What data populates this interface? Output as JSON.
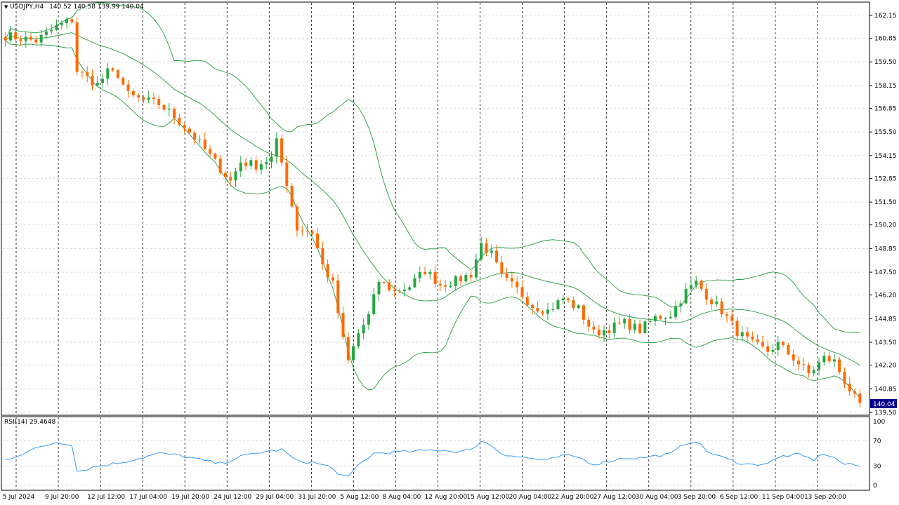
{
  "header": {
    "symbol_label": "USDJPY,H4",
    "ohlc": "140.52 140.58 139.99 140.04"
  },
  "indicator": {
    "label": "RSI(14) 29.4648"
  },
  "current_price_label": "140.04",
  "colors": {
    "bull": "#26a641",
    "bear": "#ff6a00",
    "band": "#1e9b3a",
    "rsi": "#1e90ff",
    "grid": "#c8c8c8",
    "price_box": "#00008b"
  },
  "chart_data": {
    "type": "candlestick",
    "symbol": "USDJPY",
    "timeframe": "H4",
    "y_axis_price": {
      "ticks": [
        "162.15",
        "160.85",
        "159.50",
        "158.15",
        "156.85",
        "155.50",
        "154.15",
        "152.85",
        "151.50",
        "150.20",
        "148.85",
        "147.50",
        "146.20",
        "144.85",
        "143.50",
        "142.20",
        "140.85",
        "139.50"
      ],
      "ylim": [
        139.5,
        162.15
      ]
    },
    "y_axis_rsi": {
      "ticks": [
        "100",
        "70",
        "30",
        "0"
      ],
      "ylim": [
        0,
        100
      ]
    },
    "x_axis_labels": [
      "5 Jul 2024",
      "9 Jul 20:00",
      "12 Jul 12:00",
      "17 Jul 04:00",
      "19 Jul 20:00",
      "24 Jul 12:00",
      "29 Jul 04:00",
      "31 Jul 20:00",
      "5 Aug 12:00",
      "8 Aug 04:00",
      "12 Aug 20:00",
      "15 Aug 12:00",
      "20 Aug 04:00",
      "22 Aug 20:00",
      "27 Aug 12:00",
      "30 Aug 04:00",
      "3 Sep 20:00",
      "6 Sep 12:00",
      "11 Sep 04:00",
      "13 Sep 20:00"
    ],
    "close_path": [
      [
        0,
        161.0
      ],
      [
        6,
        160.7
      ],
      [
        10,
        161.5
      ],
      [
        13,
        161.9
      ],
      [
        14,
        159.0
      ],
      [
        16,
        158.6
      ],
      [
        18,
        158.2
      ],
      [
        20,
        158.9
      ],
      [
        22,
        158.8
      ],
      [
        24,
        157.6
      ],
      [
        27,
        157.3
      ],
      [
        30,
        157.1
      ],
      [
        33,
        156.4
      ],
      [
        36,
        155.5
      ],
      [
        39,
        154.5
      ],
      [
        42,
        153.4
      ],
      [
        44,
        152.7
      ],
      [
        46,
        153.8
      ],
      [
        49,
        153.6
      ],
      [
        52,
        154.0
      ],
      [
        53,
        154.9
      ],
      [
        55,
        152.6
      ],
      [
        57,
        150.0
      ],
      [
        60,
        149.8
      ],
      [
        62,
        147.9
      ],
      [
        64,
        146.8
      ],
      [
        66,
        143.6
      ],
      [
        67,
        142.4
      ],
      [
        69,
        144.0
      ],
      [
        71,
        145.0
      ],
      [
        73,
        147.0
      ],
      [
        76,
        146.4
      ],
      [
        79,
        146.7
      ],
      [
        82,
        147.6
      ],
      [
        85,
        146.8
      ],
      [
        88,
        147.0
      ],
      [
        91,
        147.4
      ],
      [
        93,
        149.1
      ],
      [
        95,
        148.5
      ],
      [
        97,
        147.2
      ],
      [
        100,
        146.5
      ],
      [
        103,
        145.6
      ],
      [
        106,
        145.3
      ],
      [
        109,
        146.0
      ],
      [
        112,
        145.4
      ],
      [
        115,
        144.0
      ],
      [
        118,
        144.3
      ],
      [
        121,
        144.6
      ],
      [
        124,
        144.2
      ],
      [
        127,
        144.9
      ],
      [
        130,
        145.1
      ],
      [
        133,
        146.4
      ],
      [
        135,
        146.9
      ],
      [
        137,
        146.2
      ],
      [
        140,
        145.3
      ],
      [
        143,
        144.1
      ],
      [
        146,
        143.4
      ],
      [
        149,
        143.0
      ],
      [
        151,
        143.4
      ],
      [
        154,
        142.6
      ],
      [
        157,
        141.7
      ],
      [
        160,
        142.6
      ],
      [
        162,
        142.4
      ],
      [
        164,
        141.3
      ],
      [
        166,
        140.3
      ],
      [
        167,
        140.04
      ]
    ],
    "rsi_path": [
      [
        0,
        40
      ],
      [
        5,
        55
      ],
      [
        10,
        68
      ],
      [
        13,
        64
      ],
      [
        14,
        22
      ],
      [
        18,
        30
      ],
      [
        22,
        35
      ],
      [
        26,
        42
      ],
      [
        30,
        50
      ],
      [
        34,
        47
      ],
      [
        38,
        40
      ],
      [
        42,
        34
      ],
      [
        46,
        45
      ],
      [
        50,
        52
      ],
      [
        54,
        56
      ],
      [
        57,
        38
      ],
      [
        60,
        36
      ],
      [
        63,
        30
      ],
      [
        66,
        15
      ],
      [
        67,
        12
      ],
      [
        69,
        32
      ],
      [
        72,
        50
      ],
      [
        76,
        52
      ],
      [
        80,
        53
      ],
      [
        84,
        56
      ],
      [
        88,
        53
      ],
      [
        91,
        55
      ],
      [
        93,
        70
      ],
      [
        95,
        62
      ],
      [
        97,
        50
      ],
      [
        100,
        45
      ],
      [
        103,
        42
      ],
      [
        106,
        39
      ],
      [
        109,
        47
      ],
      [
        112,
        44
      ],
      [
        115,
        33
      ],
      [
        118,
        38
      ],
      [
        121,
        43
      ],
      [
        124,
        43
      ],
      [
        127,
        46
      ],
      [
        130,
        49
      ],
      [
        133,
        66
      ],
      [
        135,
        70
      ],
      [
        137,
        54
      ],
      [
        140,
        44
      ],
      [
        143,
        36
      ],
      [
        146,
        32
      ],
      [
        149,
        35
      ],
      [
        152,
        46
      ],
      [
        155,
        48
      ],
      [
        158,
        40
      ],
      [
        160,
        50
      ],
      [
        162,
        43
      ],
      [
        164,
        33
      ],
      [
        166,
        32
      ],
      [
        167,
        29.46
      ]
    ],
    "candle_count": 168
  }
}
